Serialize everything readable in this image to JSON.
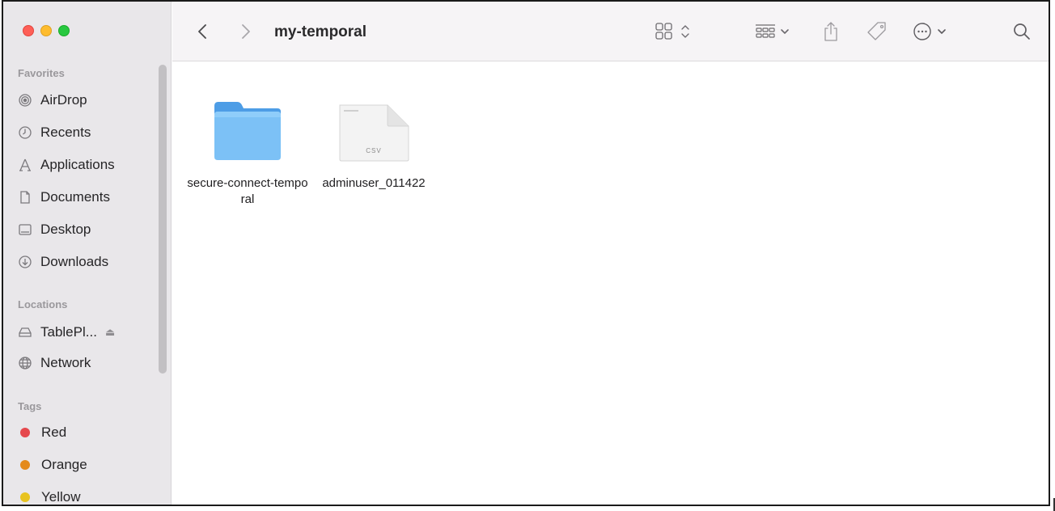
{
  "window": {
    "title": "my-temporal"
  },
  "sidebar": {
    "sections": {
      "favorites": "Favorites",
      "locations": "Locations",
      "tags": "Tags"
    },
    "favorites": [
      {
        "label": "AirDrop",
        "icon": "airdrop-icon"
      },
      {
        "label": "Recents",
        "icon": "clock-icon"
      },
      {
        "label": "Applications",
        "icon": "applications-icon"
      },
      {
        "label": "Documents",
        "icon": "document-icon"
      },
      {
        "label": "Desktop",
        "icon": "desktop-icon"
      },
      {
        "label": "Downloads",
        "icon": "download-icon"
      }
    ],
    "locations": [
      {
        "label": "TablePl...",
        "icon": "drive-icon",
        "eject": "eject-icon"
      },
      {
        "label": "Network",
        "icon": "network-icon"
      }
    ],
    "tags": [
      {
        "label": "Red",
        "color": "#e5484d"
      },
      {
        "label": "Orange",
        "color": "#e48a1c"
      },
      {
        "label": "Yellow",
        "color": "#e8c320"
      }
    ]
  },
  "toolbar": {
    "back_icon": "chevron-left-icon",
    "forward_icon": "chevron-right-icon",
    "view_icon": "icon-grid-view-icon",
    "group_icon": "group-by-icon",
    "share_icon": "share-icon",
    "tag_icon": "tag-icon",
    "more_icon": "more-icon",
    "search_icon": "search-icon"
  },
  "files": [
    {
      "name": "secure-connect-temporal",
      "kind": "folder",
      "icon": "folder-icon"
    },
    {
      "name": "adminuser_011422",
      "kind": "csv",
      "badge": "CSV",
      "icon": "csv-file-icon"
    }
  ],
  "colors": {
    "sidebar_bg": "#e9e7ea",
    "toolbar_bg": "#f6f4f6",
    "folder_blue": "#5aaef0"
  }
}
